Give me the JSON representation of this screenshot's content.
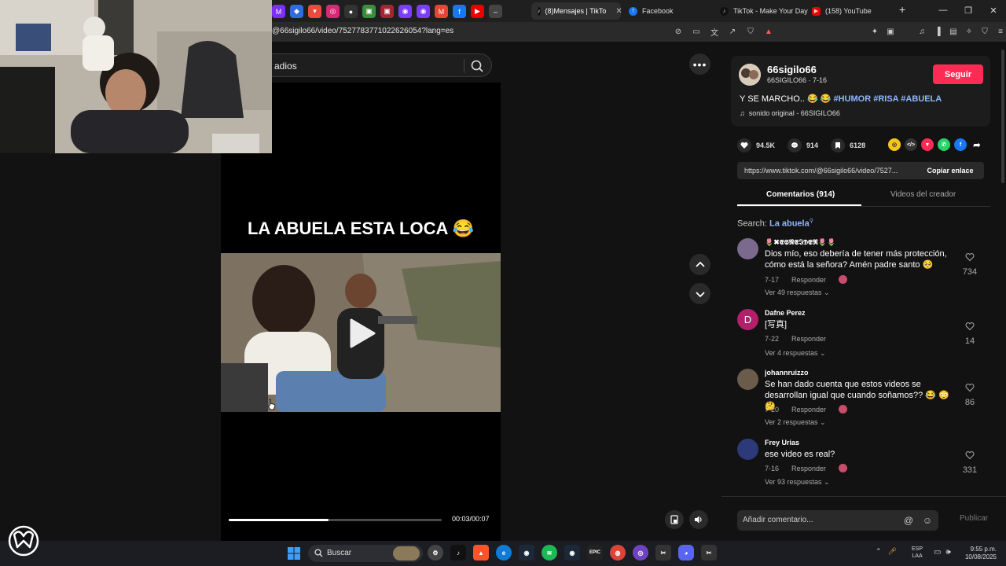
{
  "browser": {
    "tabs": [
      {
        "label": "(8)Mensajes | TikTo",
        "active": true
      },
      {
        "label": "Facebook"
      },
      {
        "label": "TikTok - Make Your Day"
      },
      {
        "label": "(158) YouTube"
      }
    ],
    "url": "@66sigilo66/video/7527783771022626054?lang=es"
  },
  "search": {
    "query": "adios"
  },
  "video": {
    "title": "LA ABUELA ESTA LOCA 😂",
    "time": "00:03/00:07",
    "progress": 0.47
  },
  "creator": {
    "username": "66sigilo66",
    "handle": "66SIGILO66 · 7-16",
    "follow_label": "Seguir",
    "caption_text": "Y SE MARCHO.. 😂 😂",
    "caption_tags": "#HUMOR #RISA #ABUELA",
    "music": "sonido original - 66SIGILO66"
  },
  "stats": {
    "likes": "94.5K",
    "comments": "914",
    "saves": "6128"
  },
  "share": {
    "url": "https://www.tiktok.com/@66sigilo66/video/7527...",
    "copy_label": "Copiar enlace"
  },
  "panel_tabs": {
    "comments": "Comentarios (914)",
    "creator_videos": "Videos del creador"
  },
  "search_suggest": {
    "prefix": "Search:",
    "term": "La abuela"
  },
  "comments": [
    {
      "user": "🌷✖𝕰𝕾𝕹𝕰𝕴𝕯𝕰𝕽🌷🌷",
      "text": "Dios mío, eso debería de tener más protección, cómo está la señora? Amén padre santo 🥺",
      "date": "7-17",
      "reply": "Responder",
      "replies": "Ver 49 respuestas ⌄",
      "likes": "734",
      "avatar_color": "#7b6a8e"
    },
    {
      "user": "Dafne Perez",
      "text": "[写真]",
      "date": "7-22",
      "reply": "Responder",
      "replies": "Ver 4 respuestas ⌄",
      "likes": "14",
      "avatar_letter": "D",
      "avatar_color": "#b31f6a"
    },
    {
      "user": "johannruizzo",
      "text": "Se han dado cuenta que estos videos se desarrollan igual que cuando soñamos?? 😂 😳 🤔",
      "date": "7-20",
      "reply": "Responder",
      "replies": "Ver 2 respuestas ⌄",
      "likes": "86",
      "avatar_color": "#6a5b4a"
    },
    {
      "user": "Frey Urias",
      "text": "ese video es real?",
      "date": "7-16",
      "reply": "Responder",
      "replies": "Ver 93 respuestas ⌄",
      "likes": "331",
      "avatar_color": "#2c3a7a"
    }
  ],
  "comment_input": {
    "placeholder": "Añadir comentario...",
    "publish": "Publicar"
  },
  "taskbar": {
    "search_label": "Buscar",
    "lang_top": "ESP",
    "lang_bottom": "LAA",
    "time": "9:55 p.m.",
    "date": "10/08/2025"
  },
  "colors": {
    "accent": "#fe2c55",
    "tag": "#8fb7ff",
    "background": "#121212"
  }
}
